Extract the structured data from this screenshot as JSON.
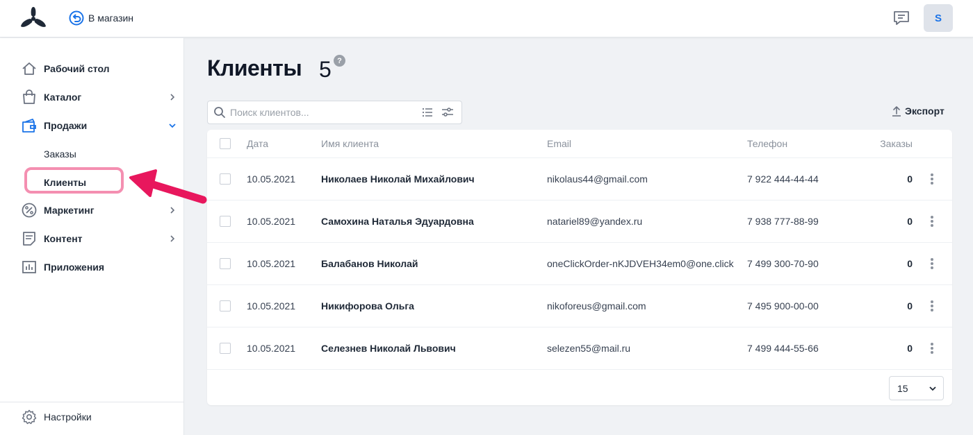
{
  "topbar": {
    "back_label": "В магазин",
    "avatar_initial": "S"
  },
  "sidebar": {
    "items": [
      {
        "label": "Рабочий стол"
      },
      {
        "label": "Каталог"
      },
      {
        "label": "Продажи"
      },
      {
        "label": "Маркетинг"
      },
      {
        "label": "Контент"
      },
      {
        "label": "Приложения"
      }
    ],
    "sub_items": [
      {
        "label": "Заказы"
      },
      {
        "label": "Клиенты"
      }
    ],
    "settings_label": "Настройки"
  },
  "page": {
    "title": "Клиенты",
    "count": "5",
    "help": "?"
  },
  "search": {
    "placeholder": "Поиск клиентов..."
  },
  "export_label": "Экспорт",
  "table": {
    "columns": [
      "Дата",
      "Имя клиента",
      "Email",
      "Телефон",
      "Заказы"
    ],
    "rows": [
      {
        "date": "10.05.2021",
        "name": "Николаев Николай Михайлович",
        "email": "nikolaus44@gmail.com",
        "phone": "7 922 444-44-44",
        "orders": "0"
      },
      {
        "date": "10.05.2021",
        "name": "Самохина Наталья Эдуардовна",
        "email": "natariel89@yandex.ru",
        "phone": "7 938 777-88-99",
        "orders": "0"
      },
      {
        "date": "10.05.2021",
        "name": "Балабанов Николай",
        "email": "oneClickOrder-nKJDVEH34em0@one.click",
        "phone": "7 499 300-70-90",
        "orders": "0"
      },
      {
        "date": "10.05.2021",
        "name": "Никифорова Ольга",
        "email": "nikoforeus@gmail.com",
        "phone": "7 495 900-00-00",
        "orders": "0"
      },
      {
        "date": "10.05.2021",
        "name": "Селезнев Николай Львович",
        "email": "selezen55@mail.ru",
        "phone": "7 499 444-55-66",
        "orders": "0"
      }
    ]
  },
  "pagination": {
    "per_page": "15"
  },
  "colors": {
    "accent": "#1a73e8",
    "highlight": "#f48fb1",
    "arrow": "#e8175d"
  }
}
